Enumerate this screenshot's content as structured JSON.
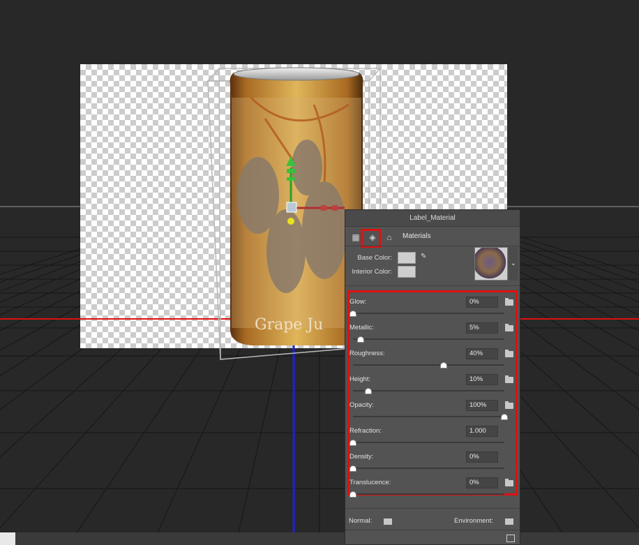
{
  "scene": {
    "can_label_text": "Grape Ju"
  },
  "panel": {
    "title": "Label_Material",
    "tabs": [
      {
        "icon": "filter-icon"
      },
      {
        "icon": "material-icon",
        "selected": true
      },
      {
        "icon": "light-icon"
      }
    ],
    "tab_label": "Materials",
    "base_color_label": "Base Color:",
    "interior_color_label": "Interior Color:",
    "properties": [
      {
        "label": "Glow:",
        "value": "0%",
        "level": 0.0,
        "has_folder": true
      },
      {
        "label": "Metallic:",
        "value": "5%",
        "level": 0.05,
        "has_folder": true
      },
      {
        "label": "Roughness:",
        "value": "40%",
        "level": 0.6,
        "has_folder": true
      },
      {
        "label": "Height:",
        "value": "10%",
        "level": 0.1,
        "has_folder": true
      },
      {
        "label": "Opacity:",
        "value": "100%",
        "level": 1.0,
        "has_folder": true
      },
      {
        "label": "Refraction:",
        "value": "1.000",
        "level": 0.0,
        "has_folder": false
      },
      {
        "label": "Density:",
        "value": "0%",
        "level": 0.0,
        "has_folder": false
      },
      {
        "label": "Translucence:",
        "value": "0%",
        "level": 0.0,
        "has_folder": true
      }
    ],
    "normal_label": "Normal:",
    "environment_label": "Environment:"
  },
  "colors": {
    "highlight_red": "#e01010",
    "axis_blue": "#1e1ee0",
    "axis_red": "#e01010",
    "axis_green": "#2aa02a",
    "panel_bg": "#535353"
  }
}
